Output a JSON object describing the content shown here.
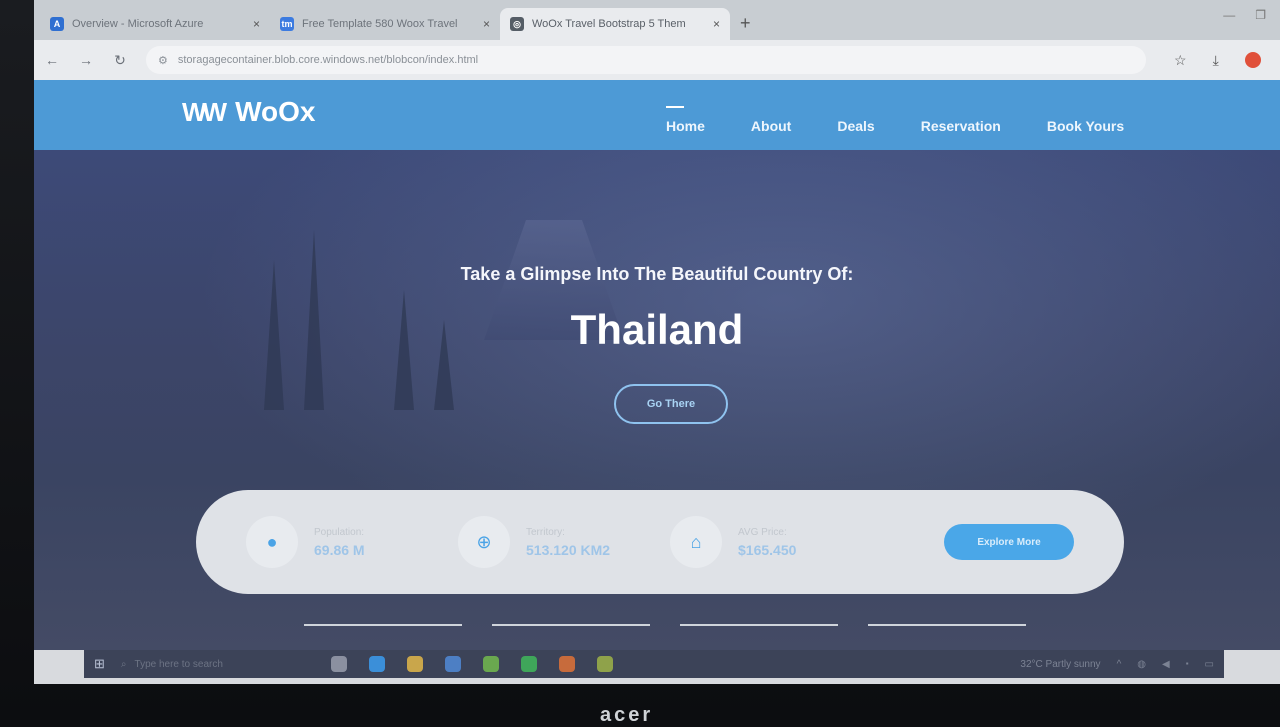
{
  "browser": {
    "tabs": [
      {
        "title": "Overview - Microsoft Azure",
        "icon": "azure-icon",
        "active": false
      },
      {
        "title": "Free Template 580 Woox Travel",
        "icon": "tm-icon",
        "active": false
      },
      {
        "title": "WoOx Travel Bootstrap 5 Them",
        "icon": "globe-icon",
        "active": true
      }
    ],
    "url": "storagagecontainer.blob.core.windows.net/blobcon/index.html",
    "new_tab_symbol": "+",
    "close_symbol": "×"
  },
  "site": {
    "logo_text": "WoOx",
    "nav": [
      {
        "label": "Home",
        "active": true
      },
      {
        "label": "About",
        "active": false
      },
      {
        "label": "Deals",
        "active": false
      },
      {
        "label": "Reservation",
        "active": false
      },
      {
        "label": "Book Yours",
        "active": false
      }
    ],
    "hero": {
      "subtitle": "Take a Glimpse Into The Beautiful Country Of:",
      "title": "Thailand",
      "button": "Go There"
    },
    "info": [
      {
        "icon": "user-icon",
        "label": "Population:",
        "value": "69.86 M"
      },
      {
        "icon": "globe-icon",
        "label": "Territory:",
        "value": "513.120 KM2"
      },
      {
        "icon": "home-icon",
        "label": "AVG Price:",
        "value": "$165.450"
      }
    ],
    "explore_button": "Explore More"
  },
  "taskbar": {
    "search_placeholder": "Type here to search",
    "weather": "32°C  Partly sunny"
  },
  "colors": {
    "header_blue": "#4d9ad6",
    "accent_blue": "#4aa7e8"
  }
}
